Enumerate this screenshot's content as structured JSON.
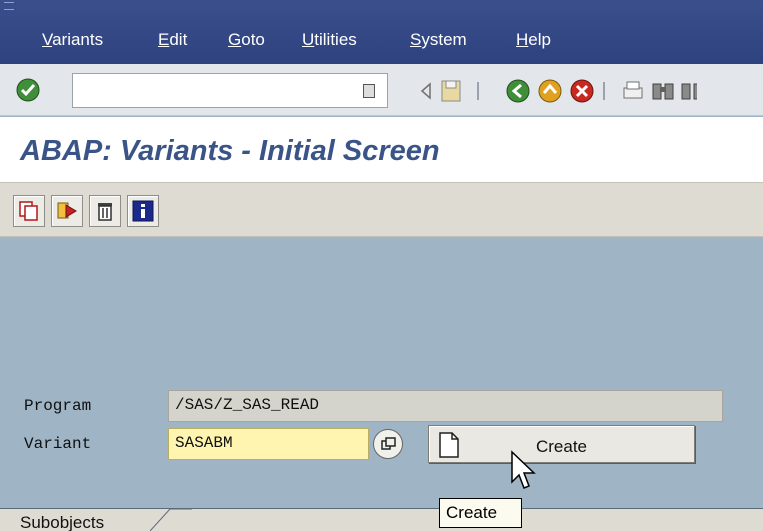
{
  "menubar": {
    "items": [
      {
        "mn": "V",
        "rest": "ariants"
      },
      {
        "mn": "E",
        "rest": "dit"
      },
      {
        "mn": "G",
        "rest": "oto"
      },
      {
        "mn": "U",
        "rest": "tilities"
      },
      {
        "mn": "S",
        "rest": "ystem"
      },
      {
        "mn": "H",
        "rest": "elp"
      }
    ]
  },
  "toolbar": {
    "command_value": "",
    "icons": [
      "check-icon",
      "back-arrow-icon",
      "save-icon",
      "back-icon",
      "exit-icon",
      "cancel-icon",
      "print-icon",
      "find-icon"
    ]
  },
  "title": "ABAP: Variants - Initial Screen",
  "app_toolbar": {
    "icons": [
      "copy-icon",
      "display-values-icon",
      "delete-icon",
      "information-icon"
    ]
  },
  "form": {
    "program_label": "Program",
    "program_value": "/SAS/Z_SAS_READ",
    "variant_label": "Variant",
    "variant_value": "SASABM",
    "create_button_label": "Create"
  },
  "tabs": {
    "first_tab_label": "Subobjects"
  },
  "tooltip": "Create",
  "colors": {
    "menubar": "#2f4280",
    "title_text": "#3a5488",
    "screen_background": "#9fb5c6",
    "input_field": "#fff5b0"
  }
}
